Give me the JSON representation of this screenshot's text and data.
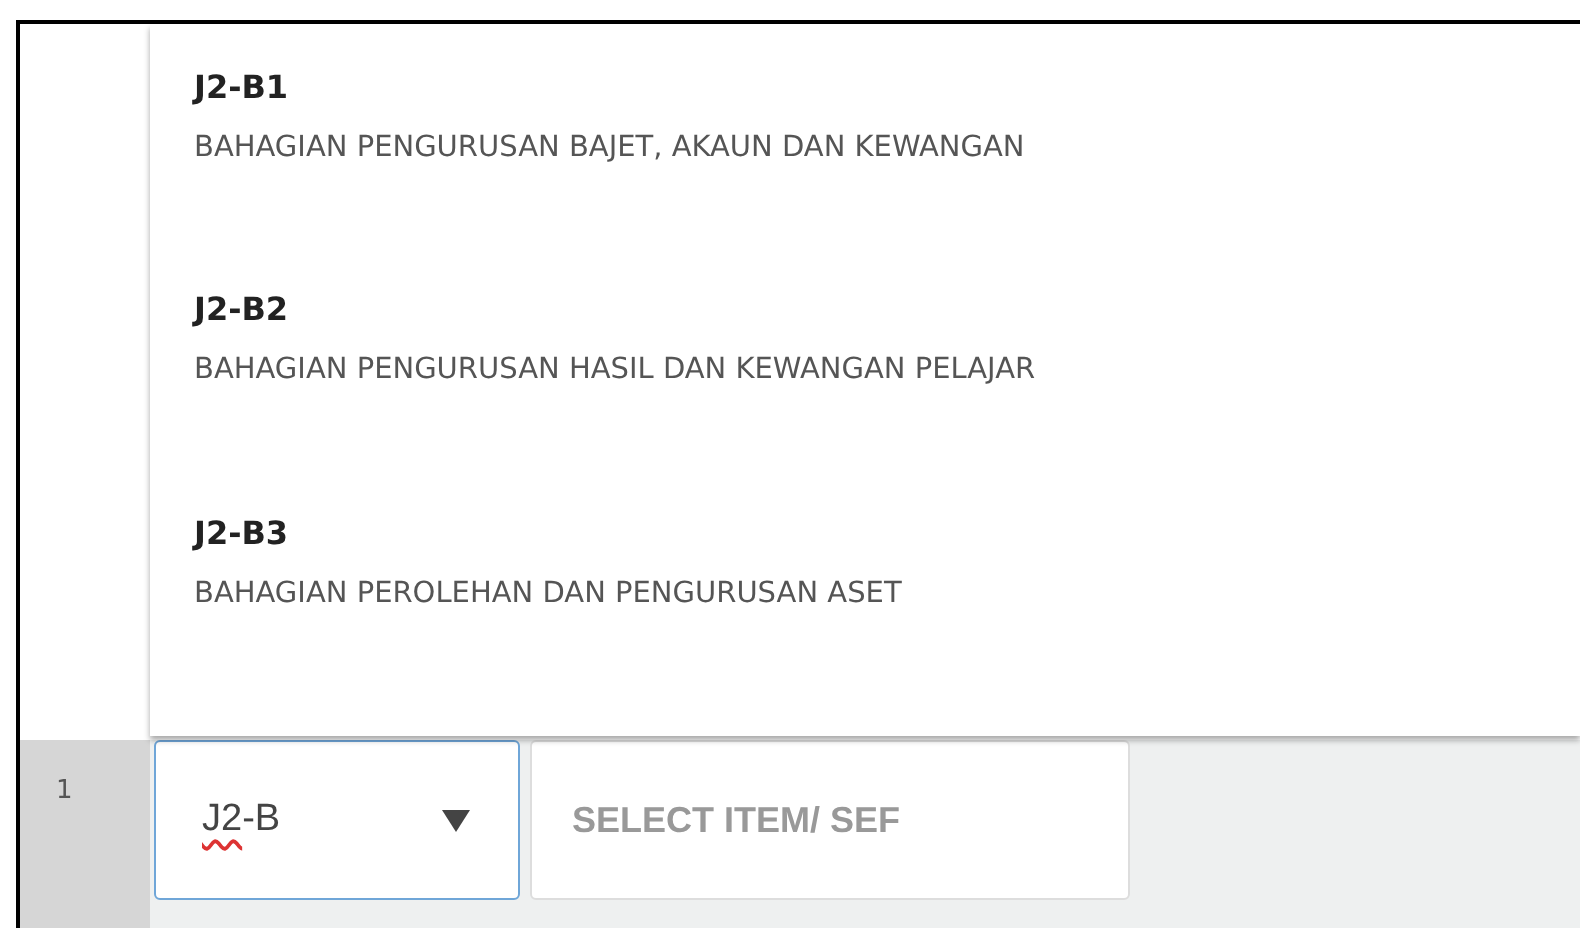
{
  "dropdown": {
    "items": [
      {
        "code": "J2-B1",
        "description": "BAHAGIAN PENGURUSAN BAJET, AKAUN DAN KEWANGAN"
      },
      {
        "code": "J2-B2",
        "description": "BAHAGIAN PENGURUSAN HASIL DAN KEWANGAN PELAJAR"
      },
      {
        "code": "J2-B3",
        "description": "BAHAGIAN PEROLEHAN DAN PENGURUSAN ASET"
      }
    ]
  },
  "row": {
    "number": "1",
    "select": {
      "focused": true,
      "value_parts": [
        {
          "text": "J2",
          "misspelled": true
        },
        {
          "text": "-B",
          "misspelled": false
        }
      ]
    },
    "search": {
      "placeholder": "SELECT ITEM/ SEF"
    }
  }
}
